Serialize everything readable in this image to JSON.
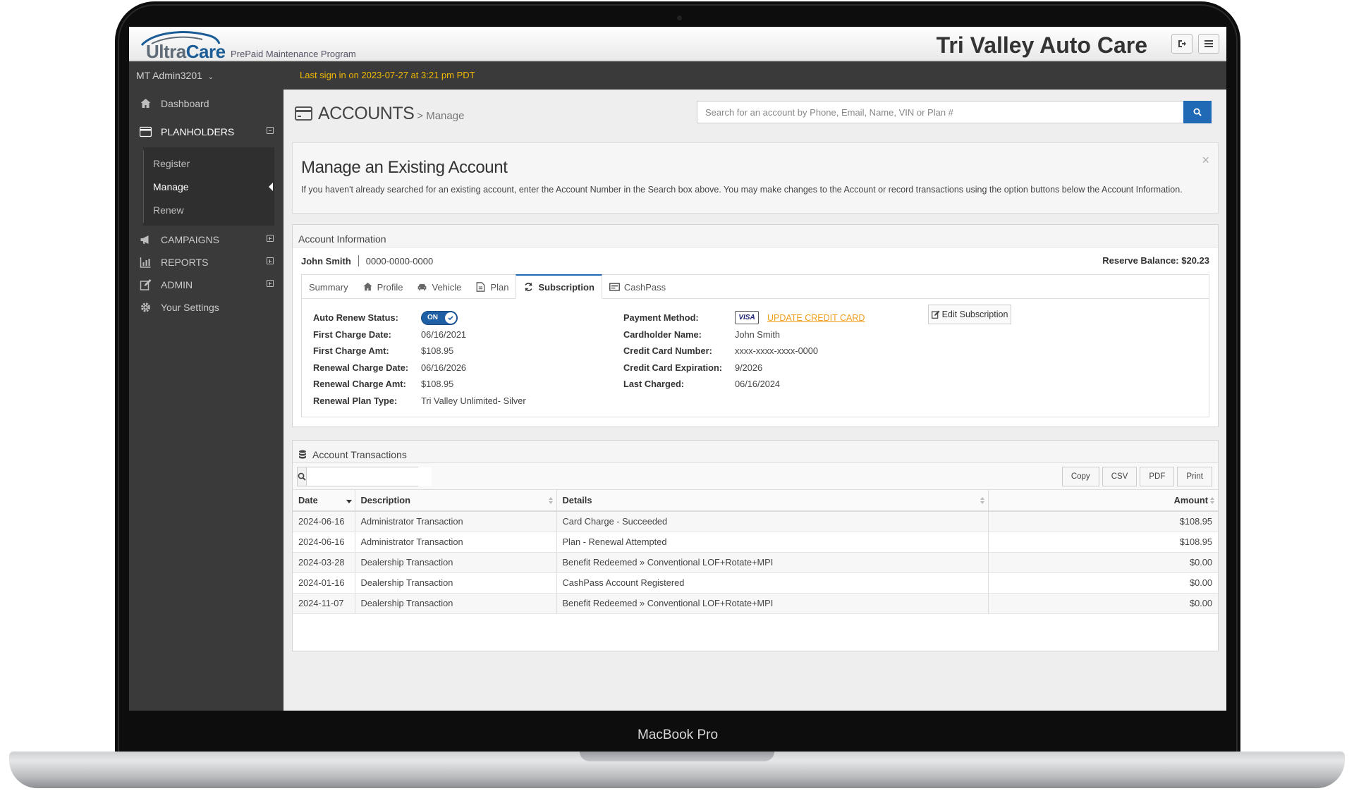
{
  "device": {
    "label": "MacBook Pro"
  },
  "app": {
    "logo": {
      "ultra": "Ultra",
      "care": "Care",
      "tagline": "PrePaid Maintenance Program"
    },
    "company": "Tri Valley Auto Care"
  },
  "user": {
    "name": "MT Admin3201"
  },
  "status": {
    "last_sign_in": "Last sign in on 2023-07-27 at 3:21 pm PDT"
  },
  "sidebar": {
    "items": [
      {
        "label": "Dashboard",
        "icon": "home-icon"
      },
      {
        "label": "PLANHOLDERS",
        "icon": "credit-card-icon"
      },
      {
        "label": "CAMPAIGNS",
        "icon": "bullhorn-icon"
      },
      {
        "label": "REPORTS",
        "icon": "bar-chart-icon"
      },
      {
        "label": "ADMIN",
        "icon": "edit-icon"
      },
      {
        "label": "Your Settings",
        "icon": "gear-icon"
      }
    ],
    "submenu": [
      "Register",
      "Manage",
      "Renew"
    ]
  },
  "page": {
    "title": "ACCOUNTS",
    "subtitle": "> Manage",
    "search_placeholder": "Search for an account by Phone, Email, Name, VIN or Plan #"
  },
  "alert": {
    "title": "Manage an Existing Account",
    "body": "If you haven't already searched for an existing account, enter the Account Number in the Search box above. You may make changes to the Account or record transactions using the option buttons below the Account Information.",
    "close": "×"
  },
  "account": {
    "panel_title": "Account Information",
    "name": "John Smith",
    "number": "0000-0000-0000",
    "reserve_balance": "Reserve Balance: $20.23",
    "tabs": [
      "Summary",
      "Profile",
      "Vehicle",
      "Plan",
      "Subscription",
      "CashPass"
    ],
    "subscription": {
      "auto_renew_label": "Auto Renew Status:",
      "auto_renew_value": "ON",
      "left": [
        {
          "label": "First Charge Date:",
          "value": "06/16/2021"
        },
        {
          "label": "First Charge Amt:",
          "value": "$108.95"
        },
        {
          "label": "Renewal Charge Date:",
          "value": "06/16/2026"
        },
        {
          "label": "Renewal Charge Amt:",
          "value": "$108.95"
        },
        {
          "label": "Renewal Plan Type:",
          "value": "Tri Valley Unlimited- Silver"
        }
      ],
      "payment_label": "Payment Method:",
      "card_brand": "VISA",
      "update_card": "UPDATE CREDIT CARD",
      "right": [
        {
          "label": "Cardholder Name:",
          "value": "John Smith"
        },
        {
          "label": "Credit Card Number:",
          "value": "xxxx-xxxx-xxxx-0000"
        },
        {
          "label": "Credit Card Expiration:",
          "value": "9/2026"
        },
        {
          "label": "Last Charged:",
          "value": "06/16/2024"
        }
      ],
      "edit_button": "Edit Subscription"
    }
  },
  "transactions": {
    "panel_title": "Account Transactions",
    "buttons": [
      "Copy",
      "CSV",
      "PDF",
      "Print"
    ],
    "columns": [
      "Date",
      "Description",
      "Details",
      "Amount"
    ],
    "rows": [
      [
        "2024-06-16",
        "Administrator Transaction",
        "Card Charge - Succeeded",
        "$108.95"
      ],
      [
        "2024-06-16",
        "Administrator Transaction",
        "Plan - Renewal Attempted",
        "$108.95"
      ],
      [
        "2024-03-28",
        "Dealership Transaction",
        "Benefit Redeemed » Conventional LOF+Rotate+MPI",
        "$0.00"
      ],
      [
        "2024-01-16",
        "Dealership Transaction",
        "CashPass Account Registered",
        "$0.00"
      ],
      [
        "2024-11-07",
        "Dealership Transaction",
        "Benefit Redeemed » Conventional LOF+Rotate+MPI",
        "$0.00"
      ]
    ]
  },
  "colors": {
    "accent": "#1f69b5",
    "sidebar": "#3a3a3a",
    "status_text": "#f0b800",
    "link": "#f09d19"
  }
}
